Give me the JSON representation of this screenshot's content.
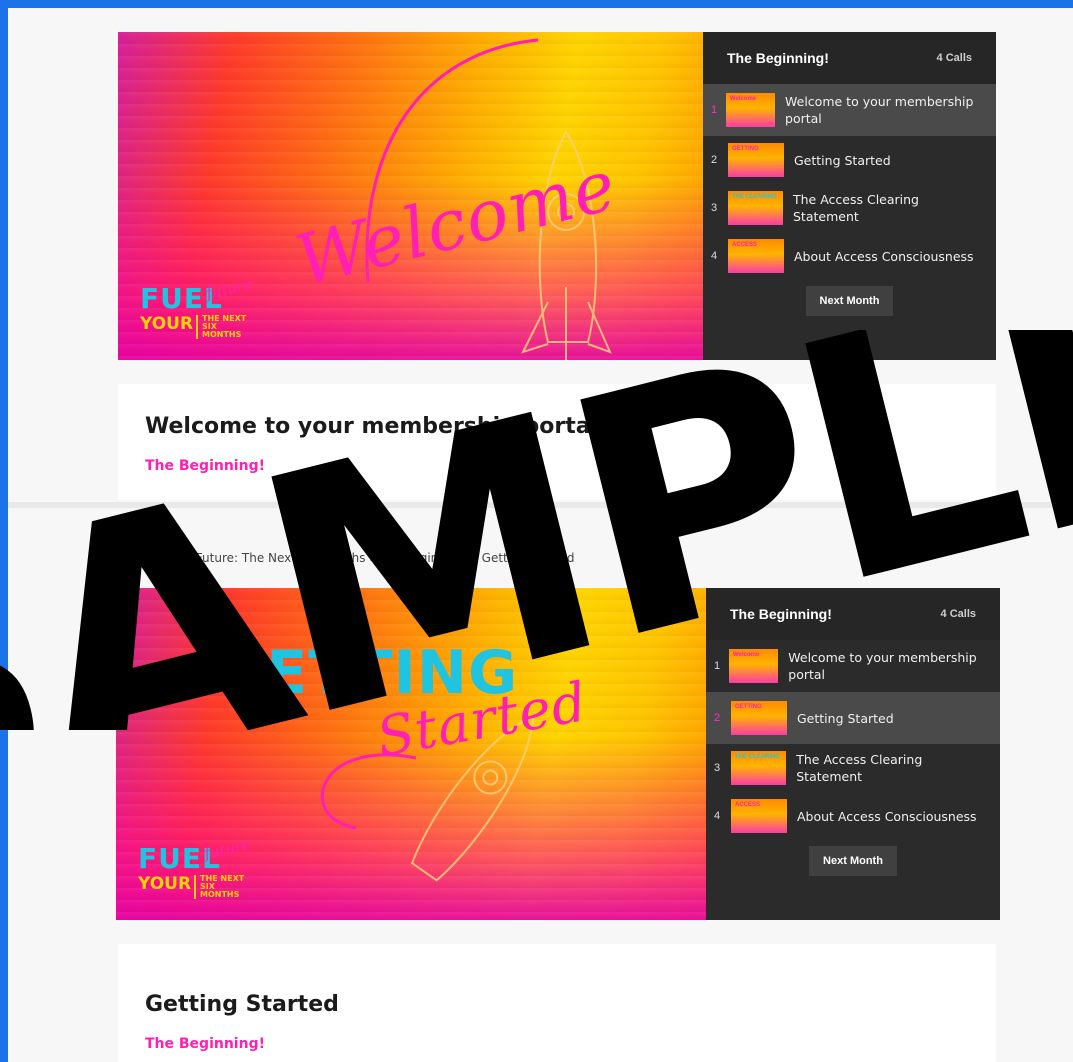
{
  "panels": [
    {
      "video_script": "Welcome",
      "playlist": {
        "title": "The Beginning!",
        "count": "4 Calls",
        "items": [
          {
            "num": "1",
            "label": "Welcome to your membership portal",
            "thumb": "Welcome"
          },
          {
            "num": "2",
            "label": "Getting Started",
            "thumb": "GETTING"
          },
          {
            "num": "3",
            "label": "The Access Clearing Statement",
            "thumb": "THE CLEARING"
          },
          {
            "num": "4",
            "label": "About Access Consciousness",
            "thumb": "ACCESS"
          }
        ],
        "active_index": 0,
        "next_button": "Next Month"
      },
      "card": {
        "title": "Welcome to your membership portal",
        "subtitle": "The Beginning!"
      }
    },
    {
      "video_script_1": "GETTING",
      "video_script_2": "Started",
      "playlist": {
        "title": "The Beginning!",
        "count": "4 Calls",
        "items": [
          {
            "num": "1",
            "label": "Welcome to your membership portal",
            "thumb": "Welcome"
          },
          {
            "num": "2",
            "label": "Getting Started",
            "thumb": "GETTING"
          },
          {
            "num": "3",
            "label": "The Access Clearing Statement",
            "thumb": "THE CLEARING"
          },
          {
            "num": "4",
            "label": "About Access Consciousness",
            "thumb": "ACCESS"
          }
        ],
        "active_index": 1,
        "next_button": "Next Month"
      },
      "card": {
        "title": "Getting Started",
        "subtitle": "The Beginning!"
      }
    }
  ],
  "breadcrumb": "Fuel Your Future: The Next Six Months  ›  The Beginning!  ›  Getting Started",
  "logo": {
    "line1": "FUEL",
    "line2": "YOUR",
    "tag": "THE NEXT SIX MONTHS",
    "script": "future"
  },
  "watermark": "SAMPLE",
  "colors": {
    "accent": "#ff1fb4",
    "playlist_bg": "#2b2b2b",
    "frame_border": "#1a73e8"
  }
}
